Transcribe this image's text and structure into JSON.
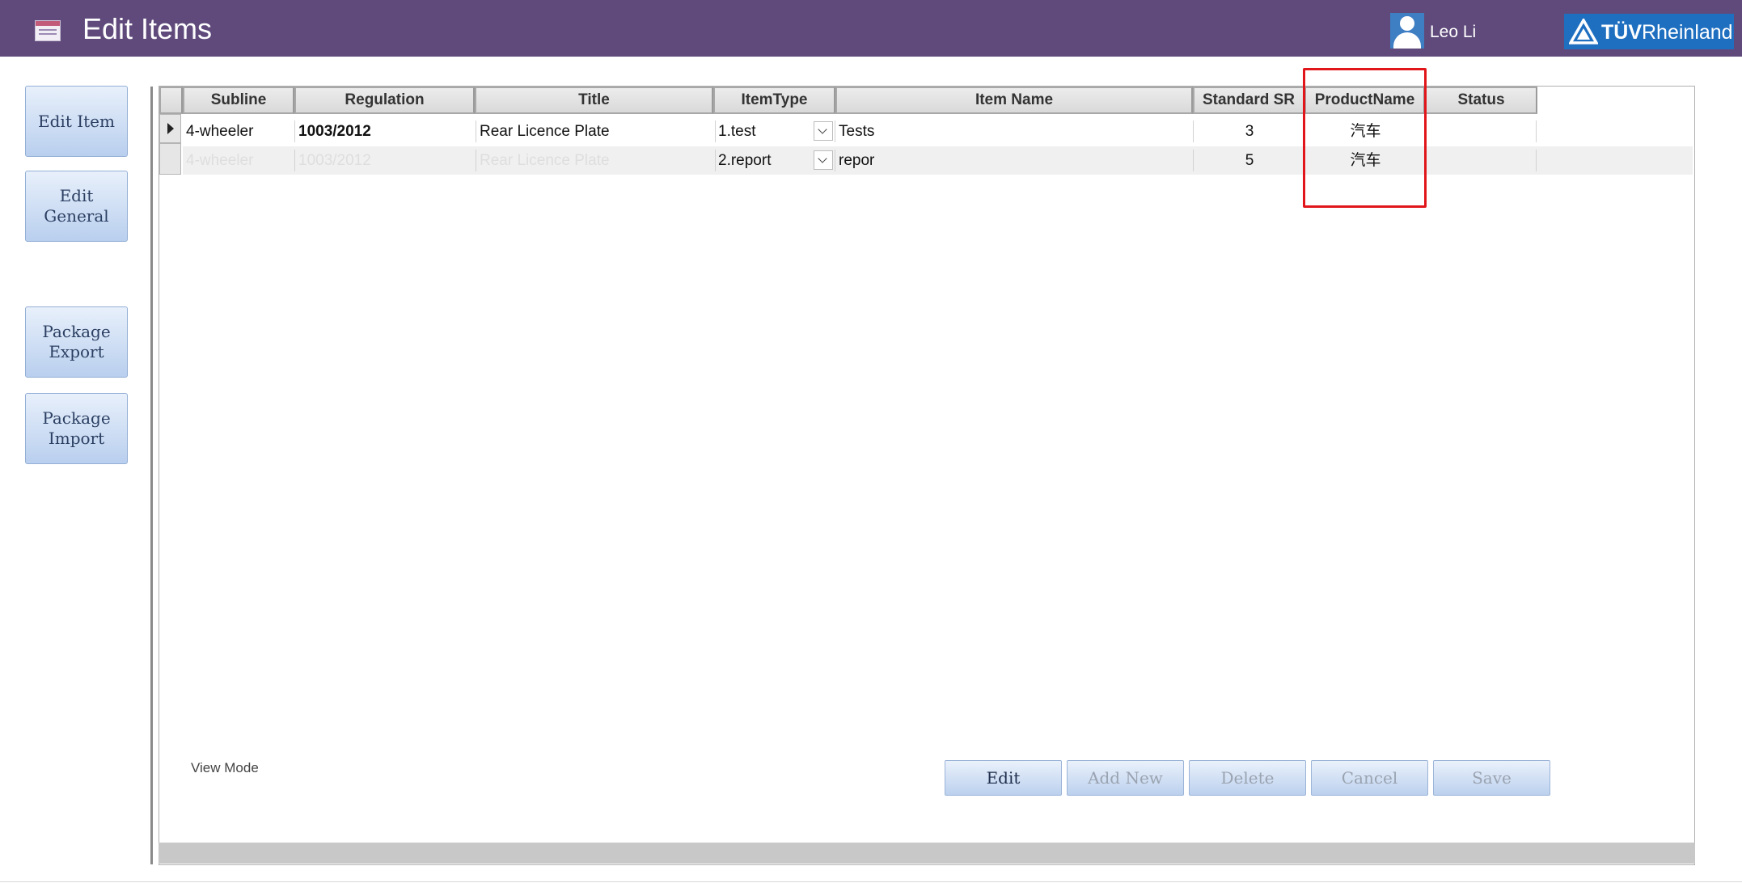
{
  "header": {
    "title": "Edit Items",
    "user_name": "Leo Li",
    "logo_text_a": "TÜV",
    "logo_text_b": "Rheinland",
    "bg_color": "#5f4a7b"
  },
  "sidebar": {
    "buttons": [
      {
        "label": "Edit Item"
      },
      {
        "label": "Edit\nGeneral"
      },
      {
        "label": "Package\nExport"
      },
      {
        "label": "Package\nImport"
      }
    ]
  },
  "grid": {
    "columns": [
      "Subline",
      "Regulation",
      "Title",
      "ItemType",
      "Item Name",
      "Standard SR",
      "ProductName",
      "Status"
    ],
    "rows": [
      {
        "subline": "4-wheeler",
        "regulation": "1003/2012",
        "title": "Rear Licence Plate",
        "item_type": "1.test",
        "item_name": "Tests",
        "standard_sr": "3",
        "product_name": "汽车",
        "status": ""
      },
      {
        "subline": "4-wheeler",
        "regulation": "1003/2012",
        "title": "Rear Licence Plate",
        "item_type": "2.report",
        "item_name": "repor",
        "standard_sr": "5",
        "product_name": "汽车",
        "status": ""
      }
    ],
    "highlight_color": "#e0161b"
  },
  "footer": {
    "mode_label": "View Mode",
    "buttons": [
      {
        "label": "Edit",
        "enabled": true
      },
      {
        "label": "Add New",
        "enabled": false
      },
      {
        "label": "Delete",
        "enabled": false
      },
      {
        "label": "Cancel",
        "enabled": false
      },
      {
        "label": "Save",
        "enabled": false
      }
    ]
  }
}
